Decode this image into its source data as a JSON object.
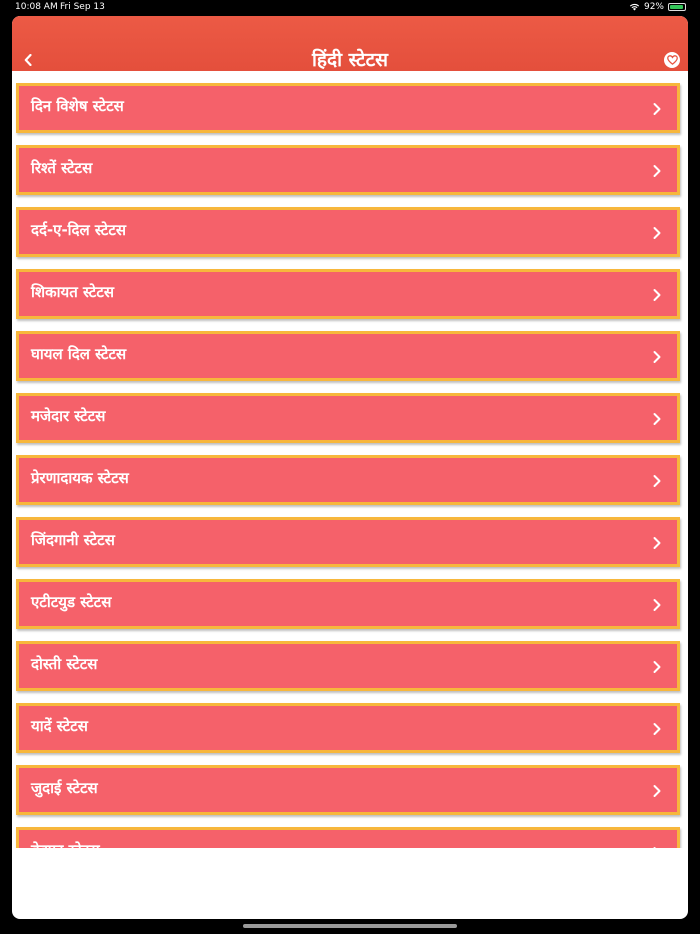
{
  "status_bar": {
    "time": "10:08 AM",
    "date": "Fri Sep 13",
    "battery": "92%",
    "battery_level": 0.92
  },
  "nav": {
    "title": "हिंदी स्टेटस",
    "back_icon": "chevron-left-icon",
    "favorite_icon": "heart-icon"
  },
  "categories": [
    {
      "label": "दिन विशेष स्टेटस"
    },
    {
      "label": "रिश्तें स्टेटस"
    },
    {
      "label": "दर्द-ए-दिल स्टेटस"
    },
    {
      "label": "शिकायत स्टेटस"
    },
    {
      "label": "घायल दिल स्टेटस"
    },
    {
      "label": "मजेदार स्टेटस"
    },
    {
      "label": "प्रेरणादायक स्टेटस"
    },
    {
      "label": "जिंदगानी स्टेटस"
    },
    {
      "label": "एटीटयुड स्टेटस"
    },
    {
      "label": "दोस्ती स्टेटस"
    },
    {
      "label": "यादें स्टेटस"
    },
    {
      "label": "जुदाई स्टेटस"
    },
    {
      "label": "बेवफा स्टेटस"
    }
  ],
  "colors": {
    "nav_bg": "#e85340",
    "item_bg": "#f5616a",
    "item_border": "#f7b73c",
    "text": "#ffffff"
  }
}
